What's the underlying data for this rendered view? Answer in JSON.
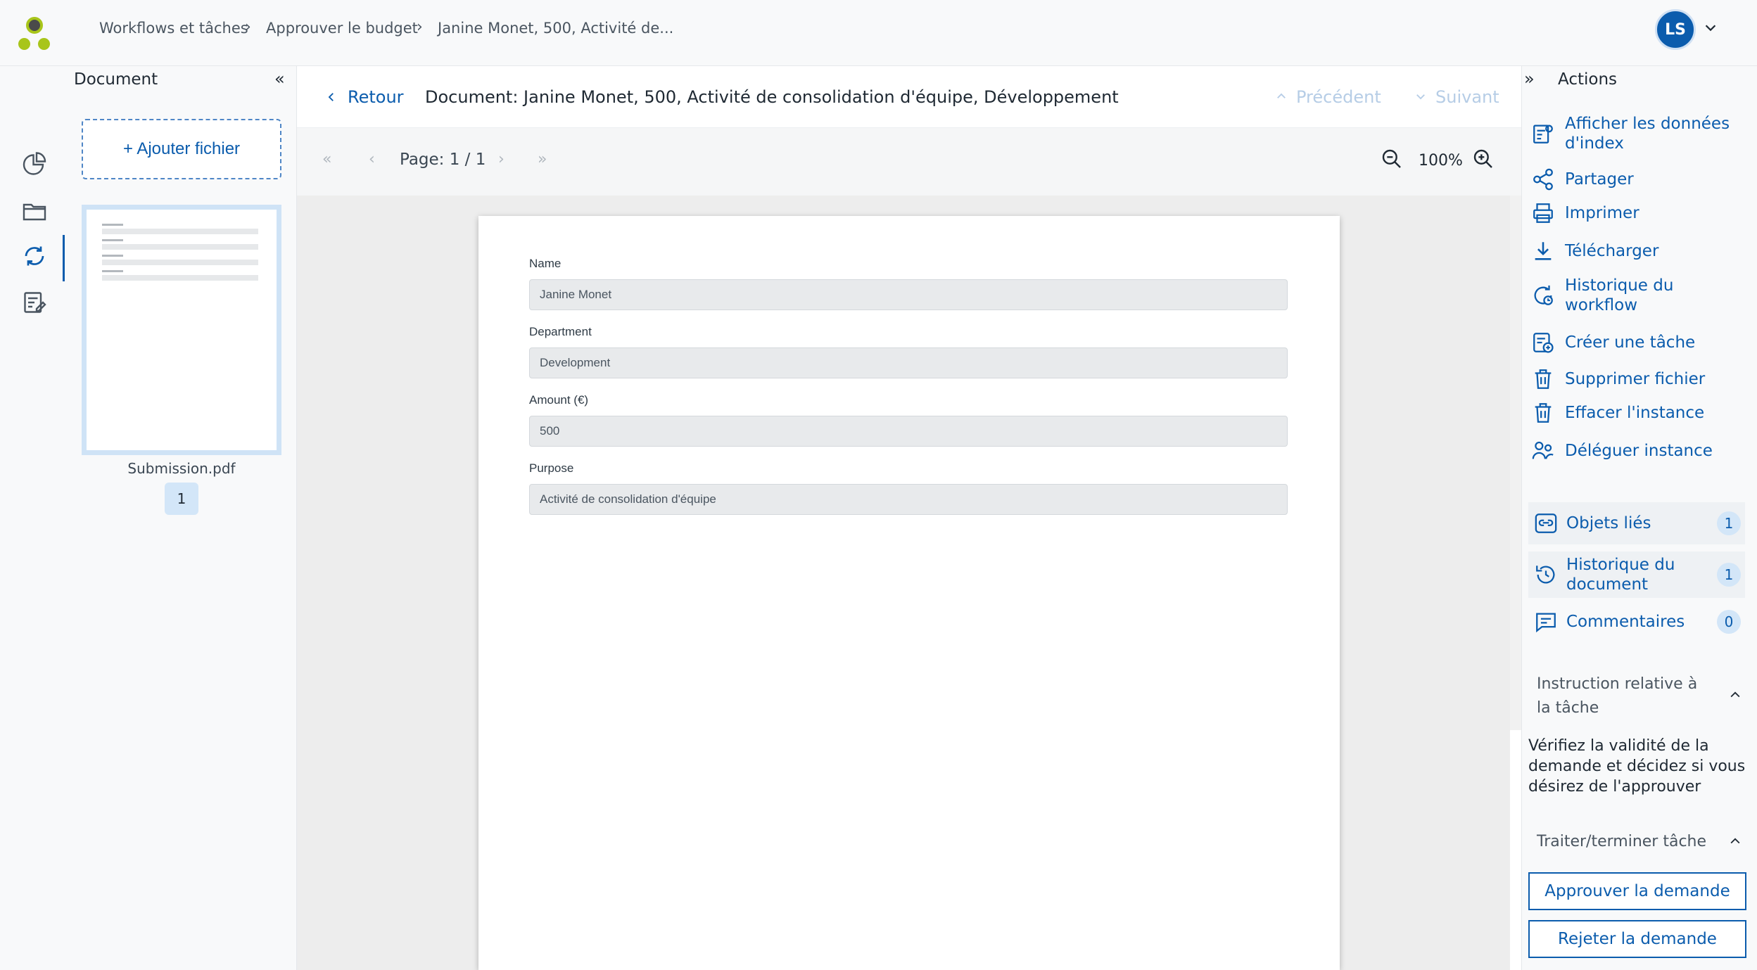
{
  "breadcrumb": {
    "items": [
      "Workflows et tâches",
      "Approuver le budget",
      "Janine Monet, 500, Activité de..."
    ]
  },
  "user": {
    "initials": "LS"
  },
  "document_panel": {
    "title": "Document",
    "add_file_label": "+ Ajouter fichier",
    "file_name": "Submission.pdf",
    "page_badge": "1"
  },
  "viewer": {
    "back_label": "Retour",
    "doc_title": "Document: Janine Monet, 500, Activité de consolidation d'équipe, Développement",
    "prev_label": "Précédent",
    "next_label": "Suivant",
    "page_label": "Page: 1 / 1",
    "zoom": "100%"
  },
  "form": {
    "fields": [
      {
        "label": "Name",
        "value": "Janine Monet"
      },
      {
        "label": "Department",
        "value": "Development"
      },
      {
        "label": "Amount (€)",
        "value": "500"
      },
      {
        "label": "Purpose",
        "value": "Activité de consolidation d'équipe"
      }
    ]
  },
  "actions": {
    "title": "Actions",
    "items": [
      {
        "label": "Afficher les données d'index",
        "icon": "index-data-icon"
      },
      {
        "label": "Partager",
        "icon": "share-icon"
      },
      {
        "label": "Imprimer",
        "icon": "print-icon"
      },
      {
        "label": "Télécharger",
        "icon": "download-icon"
      },
      {
        "label": "Historique du workflow",
        "icon": "workflow-history-icon"
      },
      {
        "label": "Créer une tâche",
        "icon": "create-task-icon"
      },
      {
        "label": "Supprimer fichier",
        "icon": "trash-icon"
      },
      {
        "label": "Effacer l'instance",
        "icon": "trash-icon"
      },
      {
        "label": "Déléguer instance",
        "icon": "delegate-icon"
      }
    ],
    "related": [
      {
        "label": "Objets liés",
        "count": "1",
        "icon": "link-icon"
      },
      {
        "label": "Historique du document",
        "count": "1",
        "icon": "history-icon"
      },
      {
        "label": "Commentaires",
        "count": "0",
        "icon": "comment-icon"
      }
    ],
    "instruction_title": "Instruction relative à la tâche",
    "instruction_text": "Vérifiez la validité de la demande et décidez si vous désirez de l'approuver",
    "process_title": "Traiter/terminer tâche",
    "approve_label": "Approuver la demande",
    "reject_label": "Rejeter la demande"
  },
  "colors": {
    "accent": "#0b5cad",
    "logo_dark": "#4a4a4a",
    "logo_green": "#a8c51a"
  }
}
